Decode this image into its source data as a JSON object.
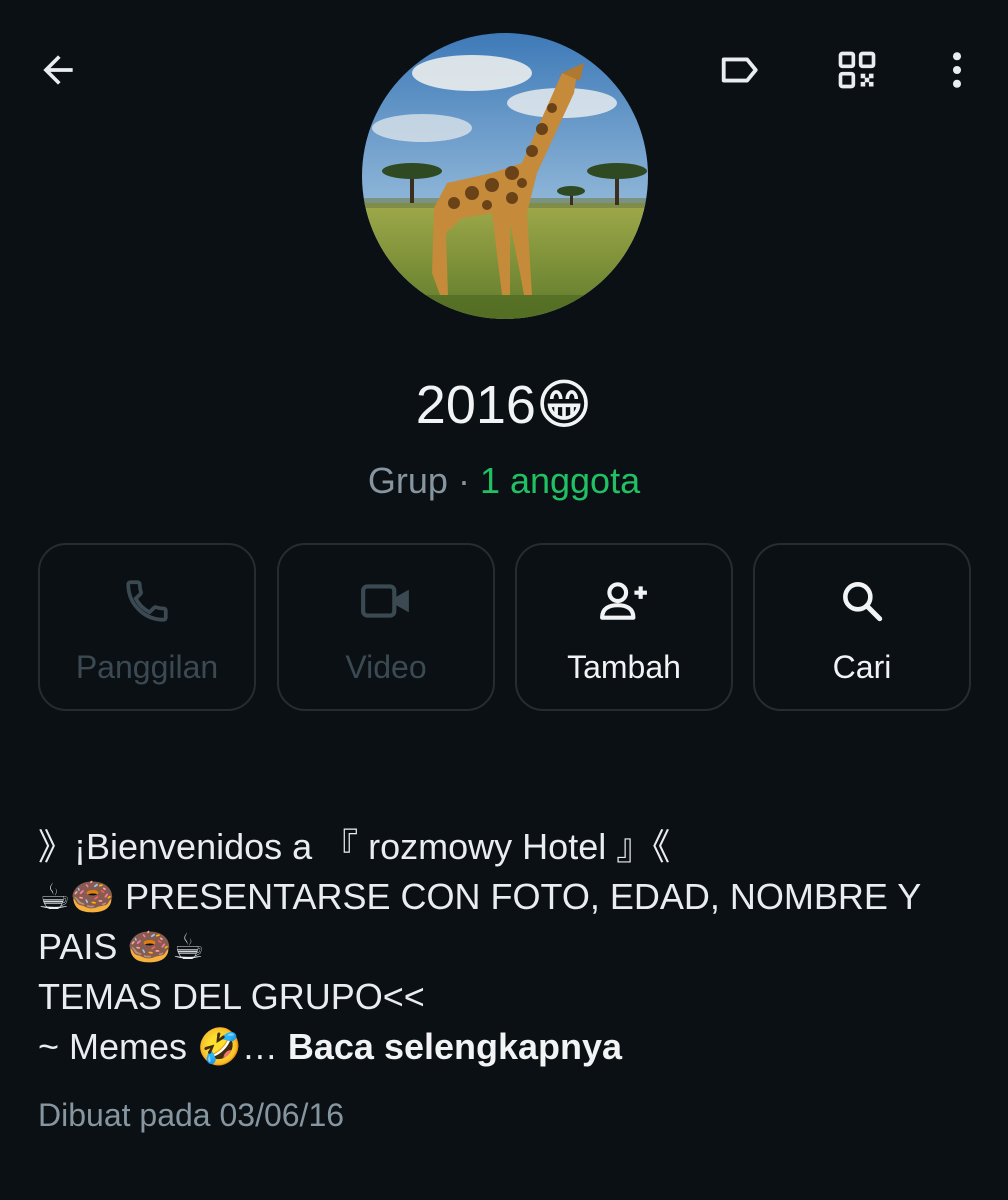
{
  "group": {
    "name": "2016😁",
    "type_label": "Grup",
    "separator": " · ",
    "members": "1 anggota",
    "avatar_alt": "giraffe-photo"
  },
  "actions": {
    "call": "Panggilan",
    "video": "Video",
    "add": "Tambah",
    "search": "Cari"
  },
  "description": {
    "line1": "》¡Bienvenidos a 『 rozmowy Hotel 』《",
    "line2": "☕🍩 PRESENTARSE CON FOTO, EDAD, NOMBRE Y",
    "line3": "PAIS 🍩☕",
    "line4": "TEMAS DEL GRUPO<<",
    "line5": "~ Memes 🤣… ",
    "read_more": "Baca selengkapnya"
  },
  "created": "Dibuat pada 03/06/16",
  "colors": {
    "background": "#0b1014",
    "accent": "#21c063",
    "muted": "#8696a0",
    "disabled": "#3b4a52"
  },
  "icons": {
    "back": "arrow-left-icon",
    "label": "label-tag-icon",
    "qr": "qr-code-icon",
    "menu": "more-vertical-icon",
    "call": "phone-icon",
    "video": "video-camera-icon",
    "add": "person-add-icon",
    "search": "search-icon"
  }
}
